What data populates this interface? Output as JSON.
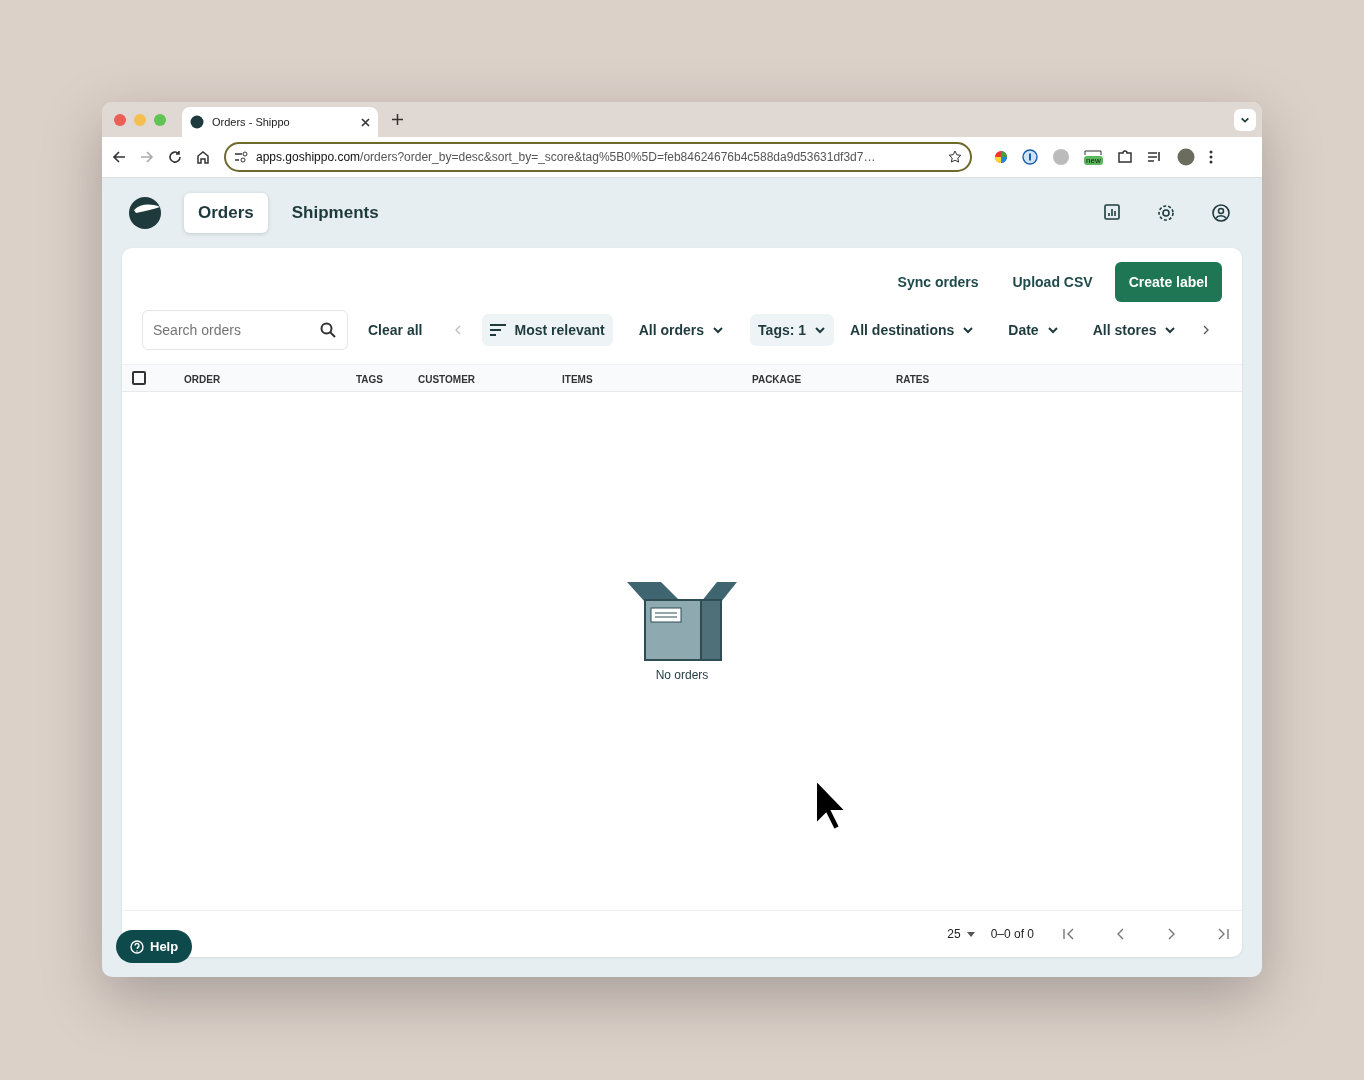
{
  "browser": {
    "tab_title": "Orders - Shippo",
    "url_host": "apps.goshippo.com",
    "url_rest": "/orders?order_by=desc&sort_by=_score&tag%5B0%5D=feb84624676b4c588da9d53631df3d7…",
    "extension_badge": "new"
  },
  "nav": {
    "tabs": [
      {
        "label": "Orders",
        "selected": true
      },
      {
        "label": "Shipments",
        "selected": false
      }
    ]
  },
  "actions": [
    {
      "label": "Sync orders",
      "kind": "text"
    },
    {
      "label": "Upload CSV",
      "kind": "text"
    },
    {
      "label": "Create label",
      "kind": "primary"
    }
  ],
  "search": {
    "placeholder": "Search orders"
  },
  "clear_all": "Clear all",
  "filters": [
    {
      "label": "Most relevant",
      "kind": "sort",
      "active": true
    },
    {
      "label": "All orders",
      "kind": "dropdown",
      "active": false
    },
    {
      "label": "Tags: 1",
      "kind": "dropdown",
      "active": true
    },
    {
      "label": "All destinations",
      "kind": "dropdown",
      "active": false
    },
    {
      "label": "Date",
      "kind": "dropdown",
      "active": false
    },
    {
      "label": "All stores",
      "kind": "dropdown",
      "active": false
    }
  ],
  "table": {
    "select_all_checked": false,
    "columns": [
      "ORDER",
      "TAGS",
      "CUSTOMER",
      "ITEMS",
      "PACKAGE",
      "RATES"
    ]
  },
  "empty_state": "No orders",
  "pagination": {
    "page_size": "25",
    "range": "0–0 of 0"
  },
  "help": "Help"
}
